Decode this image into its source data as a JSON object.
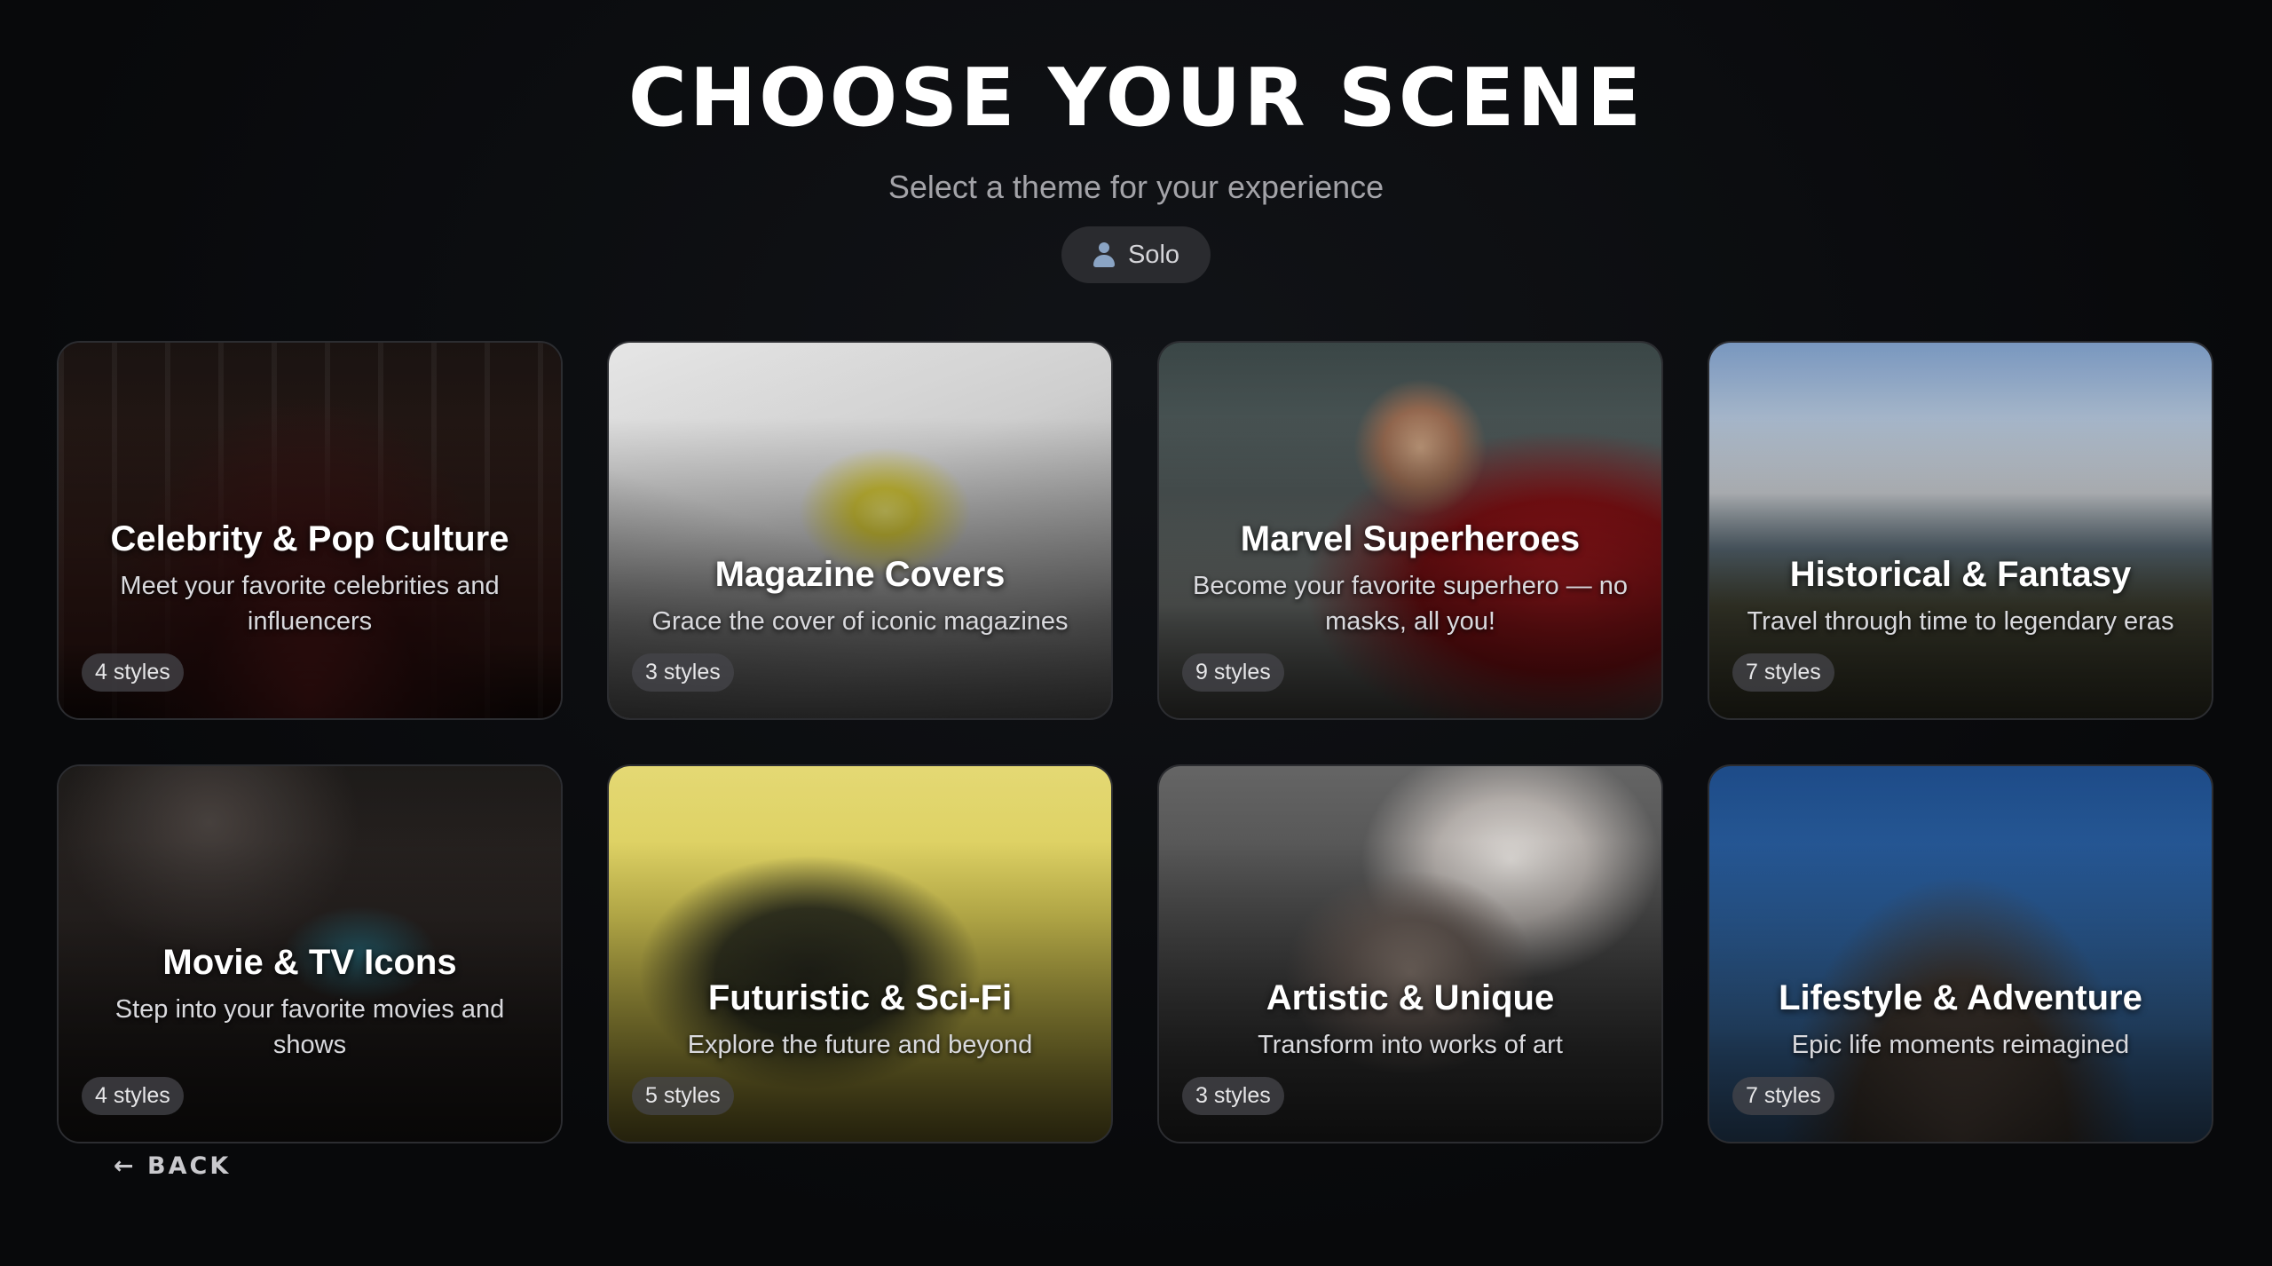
{
  "header": {
    "title": "CHOOSE YOUR SCENE",
    "subtitle": "Select a theme for your experience",
    "mode_label": "Solo"
  },
  "cards": [
    {
      "title": "Celebrity & Pop Culture",
      "description": "Meet your favorite celebrities and influencers",
      "styles": "4 styles"
    },
    {
      "title": "Magazine Covers",
      "description": "Grace the cover of iconic magazines",
      "styles": "3 styles"
    },
    {
      "title": "Marvel Superheroes",
      "description": "Become your favorite superhero — no masks, all you!",
      "styles": "9 styles"
    },
    {
      "title": "Historical & Fantasy",
      "description": "Travel through time to legendary eras",
      "styles": "7 styles"
    },
    {
      "title": "Movie & TV Icons",
      "description": "Step into your favorite movies and shows",
      "styles": "4 styles"
    },
    {
      "title": "Futuristic & Sci-Fi",
      "description": "Explore the future and beyond",
      "styles": "5 styles"
    },
    {
      "title": "Artistic & Unique",
      "description": "Transform into works of art",
      "styles": "3 styles"
    },
    {
      "title": "Lifestyle & Adventure",
      "description": "Epic life moments reimagined",
      "styles": "7 styles"
    }
  ],
  "footer": {
    "back_label": "← BACK"
  },
  "colors": {
    "background": "#090a0c",
    "pill": "#2a2b2f",
    "badge": "#46464b"
  }
}
